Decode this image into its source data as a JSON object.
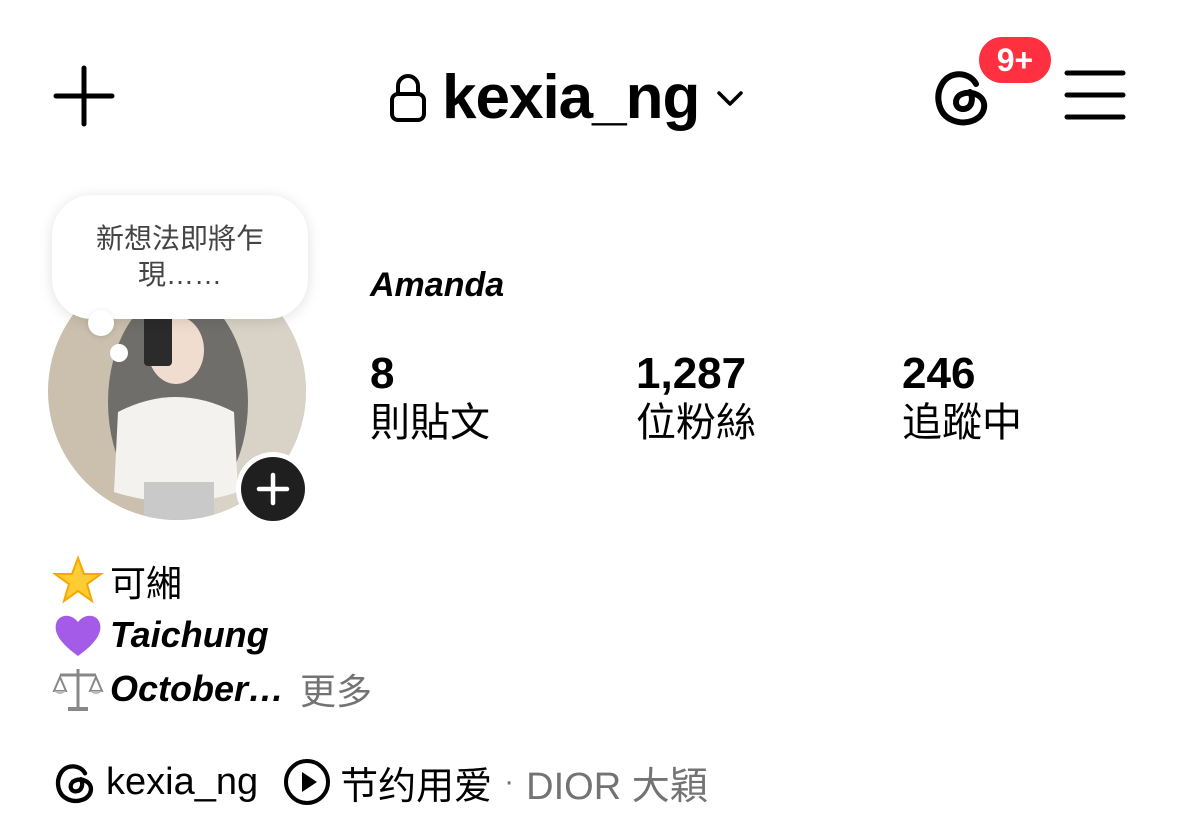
{
  "header": {
    "username": "kexia_ng",
    "notification_badge": "9+",
    "icons": [
      "plus-icon",
      "lock-icon",
      "chevron-down-icon",
      "threads-icon",
      "hamburger-menu-icon"
    ],
    "badge_color": "#ff3040"
  },
  "note_bubble": {
    "text": "新想法即將乍現……"
  },
  "profile": {
    "display_name": "Amanda",
    "stats": [
      {
        "value": "8",
        "label": "則貼文"
      },
      {
        "value": "1,287",
        "label": "位粉絲"
      },
      {
        "value": "246",
        "label": "追蹤中"
      }
    ]
  },
  "bio": {
    "line1": {
      "icon": "glowing-star-icon",
      "text": "可緗"
    },
    "line2": {
      "icon": "purple-heart-icon",
      "text": "Taichung"
    },
    "line3": {
      "icon": "balance-scale-icon",
      "text": "October…",
      "more": "更多"
    }
  },
  "links": {
    "threads_handle": "kexia_ng",
    "music_title": "节约用爱",
    "separator": "·",
    "music_artist": "DIOR 大穎"
  }
}
